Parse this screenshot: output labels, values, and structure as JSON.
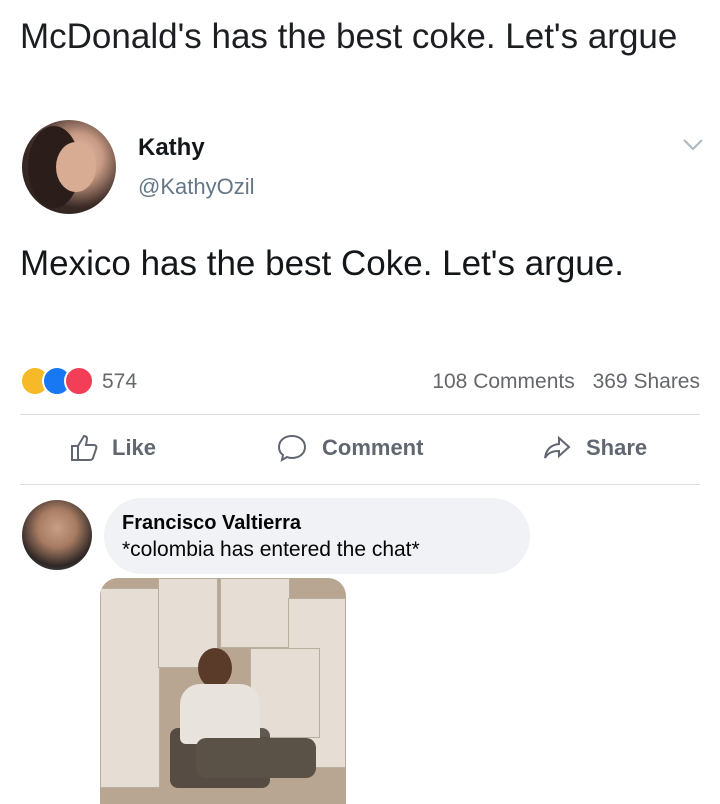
{
  "caption": "McDonald's has the best coke. Let's argue",
  "tweet": {
    "name": "Kathy",
    "handle": "@KathyOzil",
    "body": "Mexico has the best Coke. Let's argue."
  },
  "stats": {
    "reactions_count": "574",
    "comments": "108 Comments",
    "shares": "369 Shares",
    "reaction_icons": [
      "haha-icon",
      "like-icon",
      "love-icon"
    ]
  },
  "actions": {
    "like_label": "Like",
    "comment_label": "Comment",
    "share_label": "Share"
  },
  "comment": {
    "author": "Francisco Valtierra",
    "text": "*colombia has entered the chat*"
  },
  "colors": {
    "text": "#1c1e21",
    "muted": "#65676b",
    "bubble": "#f0f2f5",
    "like_blue": "#1877f2",
    "love_red": "#f33e58",
    "haha_yellow": "#f7b928"
  }
}
